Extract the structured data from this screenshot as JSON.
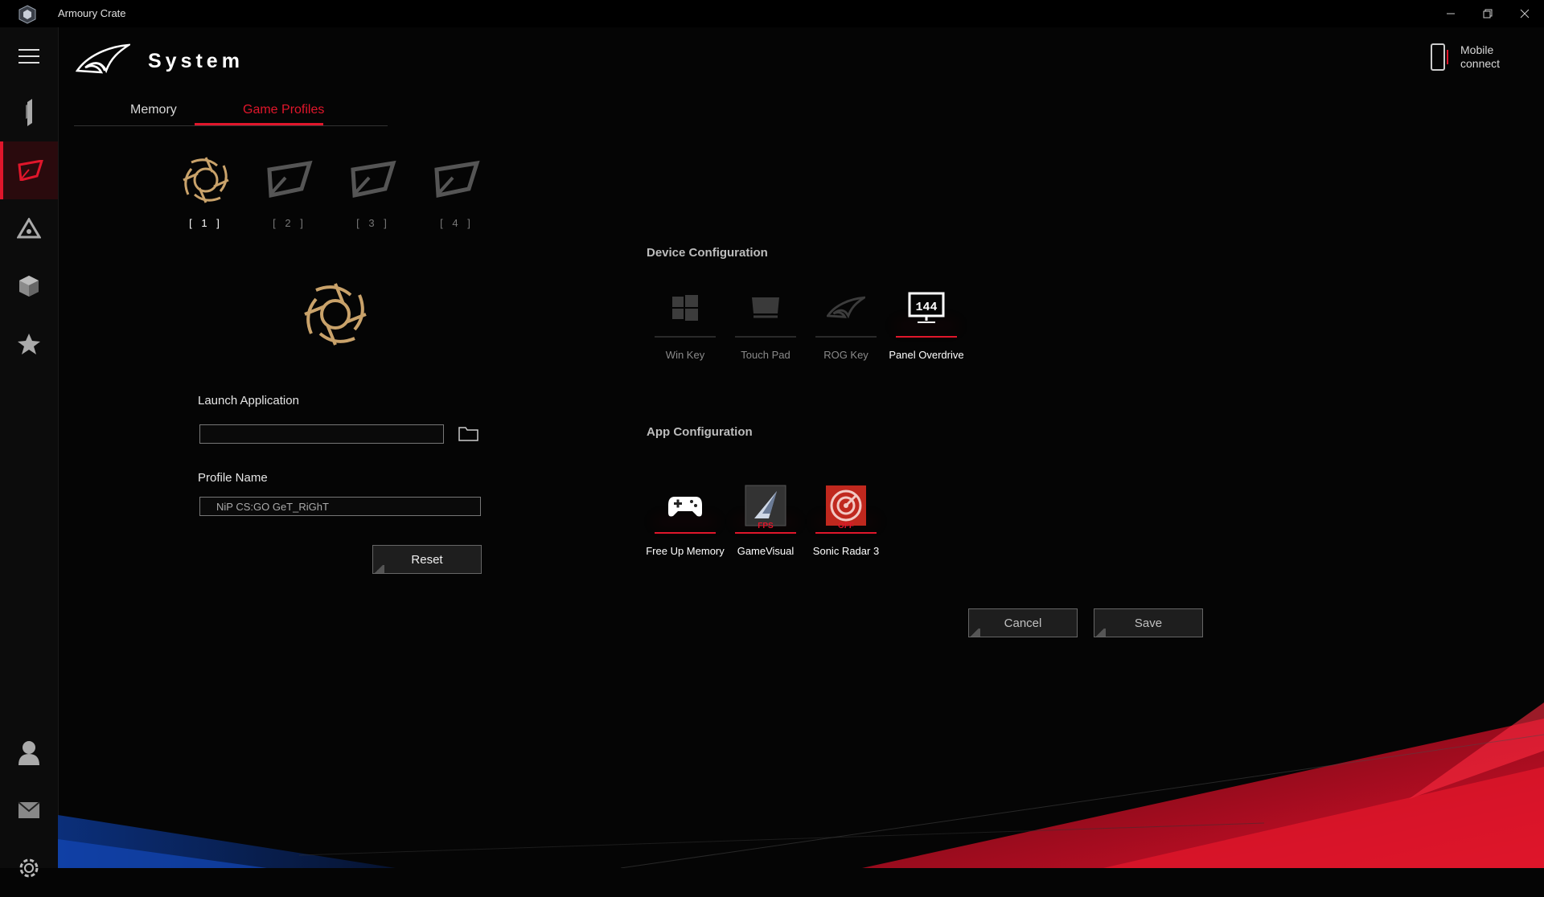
{
  "window": {
    "title": "Armoury Crate"
  },
  "header": {
    "title": "System",
    "mobile_connect_label": "Mobile connect"
  },
  "tabs": [
    {
      "label": "Memory",
      "active": false
    },
    {
      "label": "Game Profiles",
      "active": true
    }
  ],
  "profiles": [
    {
      "label": "[ 1 ]",
      "active": true
    },
    {
      "label": "[ 2 ]",
      "active": false
    },
    {
      "label": "[ 3 ]",
      "active": false
    },
    {
      "label": "[ 4 ]",
      "active": false
    }
  ],
  "form": {
    "launch_application_label": "Launch Application",
    "launch_application_value": "",
    "profile_name_label": "Profile Name",
    "profile_name_value": "NiP CS:GO GeT_RiGhT",
    "reset_label": "Reset"
  },
  "device_configuration": {
    "title": "Device Configuration",
    "items": [
      {
        "label": "Win Key",
        "icon": "windows-icon",
        "enabled": false
      },
      {
        "label": "Touch Pad",
        "icon": "touchpad-icon",
        "enabled": false
      },
      {
        "label": "ROG Key",
        "icon": "rog-key-icon",
        "enabled": false
      },
      {
        "label": "Panel Overdrive",
        "icon": "monitor-144-icon",
        "enabled": true,
        "icon_text": "144"
      }
    ]
  },
  "app_configuration": {
    "title": "App Configuration",
    "items": [
      {
        "label": "Free Up Memory",
        "icon": "gamepad-icon",
        "status": "",
        "enabled": true
      },
      {
        "label": "GameVisual",
        "icon": "gamevisual-icon",
        "status": "FPS",
        "enabled": true
      },
      {
        "label": "Sonic Radar 3",
        "icon": "sonic-radar-icon",
        "status": "OFF",
        "enabled": true
      }
    ]
  },
  "actions": {
    "cancel_label": "Cancel",
    "save_label": "Save"
  },
  "colors": {
    "accent": "#e0162b",
    "background": "#050505",
    "sidebar": "#0c0c0c",
    "emblem_gold": "#c9a26a"
  }
}
